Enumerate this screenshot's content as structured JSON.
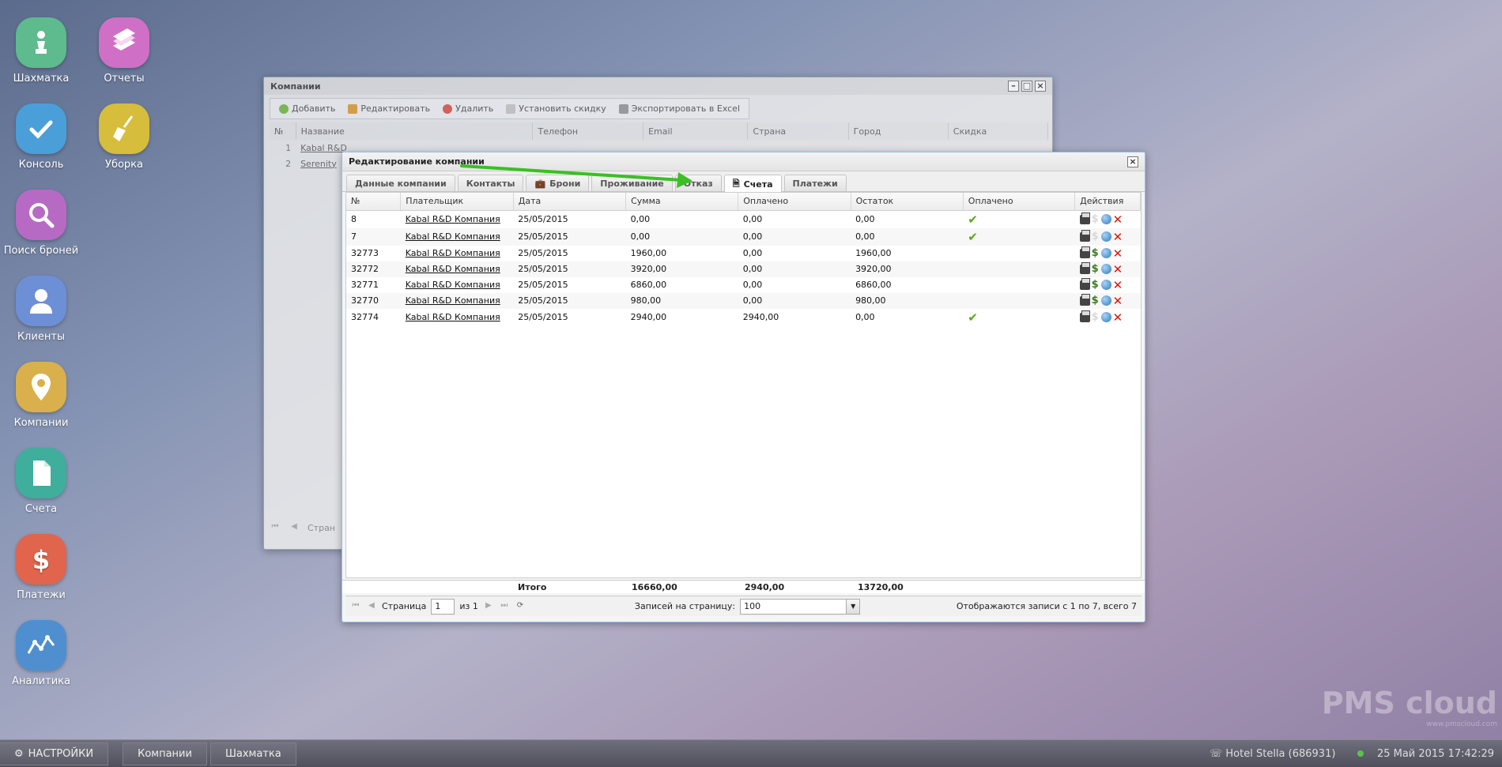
{
  "desktop": {
    "icons": [
      {
        "label": "Шахматка",
        "icon": "chess-pawn-icon",
        "color": "#5dbb8e"
      },
      {
        "label": "Отчеты",
        "icon": "books-icon",
        "color": "#cf6fc5"
      },
      {
        "label": "Консоль",
        "icon": "checkmark-icon",
        "color": "#4a9fd8"
      },
      {
        "label": "Уборка",
        "icon": "broom-icon",
        "color": "#d6bd3b"
      },
      {
        "label": "Поиск броней",
        "icon": "magnifier-icon",
        "color": "#b76ac4"
      },
      {
        "label": "Клиенты",
        "icon": "person-icon",
        "color": "#6d8fd6"
      },
      {
        "label": "Компании",
        "icon": "location-pin-icon",
        "color": "#d9b04b"
      },
      {
        "label": "Счета",
        "icon": "document-icon",
        "color": "#3fae9c"
      },
      {
        "label": "Платежи",
        "icon": "dollar-icon",
        "color": "#e0654c"
      },
      {
        "label": "Аналитика",
        "icon": "chart-line-icon",
        "color": "#4f8fcf"
      }
    ]
  },
  "bg_window": {
    "title": "Компании",
    "toolbar": [
      "Добавить",
      "Редактировать",
      "Удалить",
      "Установить скидку",
      "Экспортировать в Excel"
    ],
    "columns": [
      "№",
      "Название",
      "Телефон",
      "Email",
      "Страна",
      "Город",
      "Скидка"
    ],
    "rows": [
      {
        "num": "1",
        "name": "Kabal R&D"
      },
      {
        "num": "2",
        "name": "Serenity"
      }
    ],
    "pager_text": "Стран"
  },
  "dialog": {
    "title": "Редактирование компании",
    "tabs": [
      "Данные компании",
      "Контакты",
      "Брони",
      "Проживание",
      "Отказ",
      "Счета",
      "Платежи"
    ],
    "active_tab": "Счета",
    "columns": [
      "№",
      "Плательщик",
      "Дата",
      "Сумма",
      "Оплачено",
      "Остаток",
      "Оплачено",
      "Действия"
    ],
    "rows": [
      {
        "num": "8",
        "payer": "Kabal R&D Компания",
        "date": "25/05/2015",
        "sum": "0,00",
        "paid": "0,00",
        "rest": "0,00",
        "paid_flag": "✔"
      },
      {
        "num": "7",
        "payer": "Kabal R&D Компания",
        "date": "25/05/2015",
        "sum": "0,00",
        "paid": "0,00",
        "rest": "0,00",
        "paid_flag": "✔"
      },
      {
        "num": "32773",
        "payer": "Kabal R&D Компания",
        "date": "25/05/2015",
        "sum": "1960,00",
        "paid": "0,00",
        "rest": "1960,00",
        "paid_flag": ""
      },
      {
        "num": "32772",
        "payer": "Kabal R&D Компания",
        "date": "25/05/2015",
        "sum": "3920,00",
        "paid": "0,00",
        "rest": "3920,00",
        "paid_flag": ""
      },
      {
        "num": "32771",
        "payer": "Kabal R&D Компания",
        "date": "25/05/2015",
        "sum": "6860,00",
        "paid": "0,00",
        "rest": "6860,00",
        "paid_flag": ""
      },
      {
        "num": "32770",
        "payer": "Kabal R&D Компания",
        "date": "25/05/2015",
        "sum": "980,00",
        "paid": "0,00",
        "rest": "980,00",
        "paid_flag": ""
      },
      {
        "num": "32774",
        "payer": "Kabal R&D Компания",
        "date": "25/05/2015",
        "sum": "2940,00",
        "paid": "2940,00",
        "rest": "0,00",
        "paid_flag": "✔"
      }
    ],
    "totals": {
      "label": "Итого",
      "sum": "16660,00",
      "paid": "2940,00",
      "rest": "13720,00"
    },
    "pager": {
      "page_label": "Страница",
      "page_value": "1",
      "of_label": "из 1",
      "per_page_label": "Записей на страницу:",
      "per_page_value": "100",
      "summary": "Отображаются записи с 1 по 7, всего 7"
    }
  },
  "taskbar": {
    "settings": "НАСТРОЙКИ",
    "windows": [
      "Компании",
      "Шахматка"
    ],
    "hotel": "Hotel Stella (686931)",
    "datetime": "25 Май 2015 17:42:29"
  },
  "watermark": {
    "brand": "PMS cloud",
    "url": "www.pmscloud.com"
  }
}
